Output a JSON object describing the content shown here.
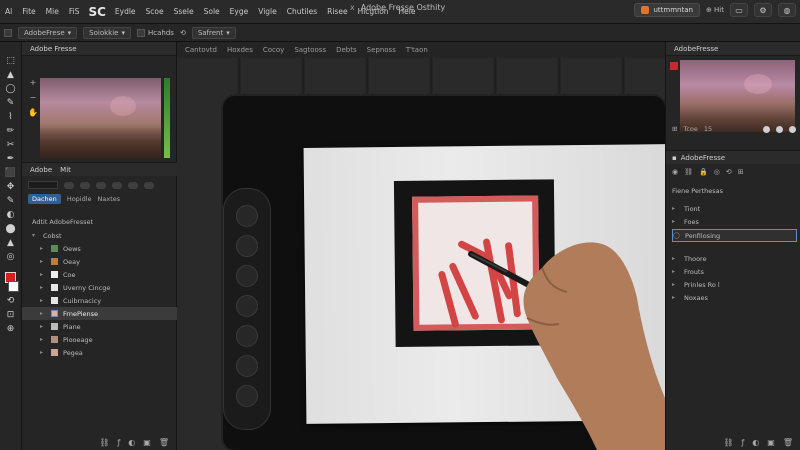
{
  "menubar": {
    "brand_small": "Al",
    "items_left": [
      "Fite",
      "Mie",
      "FiS"
    ],
    "brand_big": "SC",
    "items": [
      "Eydle",
      "Scoe",
      "Ssele",
      "Sole",
      "Eyge",
      "Vigle",
      "Chutiles",
      "Risee",
      "Hicgtion",
      "Hele"
    ],
    "window_title": "Adobe Fresse Osthity",
    "close_glyph": "x",
    "workspace_label": "uttmmntan",
    "right_text": "⊕ Hit"
  },
  "optionbar": {
    "items": [
      "AdobeFrese",
      "Soiokkie",
      "Hcahds",
      "Safrent"
    ]
  },
  "tabrow": {
    "tabs": [
      "Cantovtd",
      "Hoxdes",
      "Cocoy",
      "Sagtooss",
      "Debts",
      "Sepnoss",
      "T'taon"
    ]
  },
  "toolbar": {
    "tools": [
      "⬚",
      "▲",
      "◯",
      "✎",
      "⌇",
      "✏",
      "✂",
      "✒",
      "⬛",
      "✥",
      "✎",
      "◐",
      "⬤",
      "▲",
      "◎",
      "⟲",
      "⊡",
      "⊕"
    ]
  },
  "leftpanel": {
    "header": "Adobe Fresse",
    "layers_tabs": [
      "Adobe",
      "Mit"
    ],
    "field": "",
    "subtabs": [
      "Dachen",
      "Hopidle",
      "Naxtes"
    ],
    "group_label": "Adtit AdobeFresset",
    "group_name": "Cobst",
    "layers": [
      {
        "name": "Oews",
        "thumb": "#5f8a5a"
      },
      {
        "name": "Oeay",
        "thumb": "#c47a35"
      },
      {
        "name": "Coe",
        "thumb": "#eeeeee"
      },
      {
        "name": "Uverny Cincge",
        "thumb": "#e6e6e6"
      },
      {
        "name": "Cuibrnacicy",
        "thumb": "#e6e6e6"
      },
      {
        "name": "FrnePiense",
        "thumb": "#d7b1b1"
      },
      {
        "name": "Piane",
        "thumb": "#bababa"
      },
      {
        "name": "Piooeage",
        "thumb": "#b28f7e"
      },
      {
        "name": "Pegea",
        "thumb": "#c8a796"
      }
    ]
  },
  "rightpanel": {
    "header": "AdobeFresse",
    "row1_labels": [
      "Tcoe",
      "15"
    ],
    "sec2_header": "AdobeFresse",
    "props_label": "Fiene Perthesas",
    "items": [
      {
        "name": "Tiont",
        "sel": false
      },
      {
        "name": "Foes",
        "sel": false
      },
      {
        "name": "Penfilosing",
        "sel": true
      },
      {
        "name": "Thoore",
        "sel": false
      },
      {
        "name": "Frouts",
        "sel": false
      },
      {
        "name": "Prinles Ro l",
        "sel": false
      },
      {
        "name": "Noxaes",
        "sel": false
      }
    ]
  },
  "colors": {
    "accent_blue": "#2e5f95",
    "foreground_swatch": "#d81e1e",
    "art_red": "#d35b5b"
  }
}
